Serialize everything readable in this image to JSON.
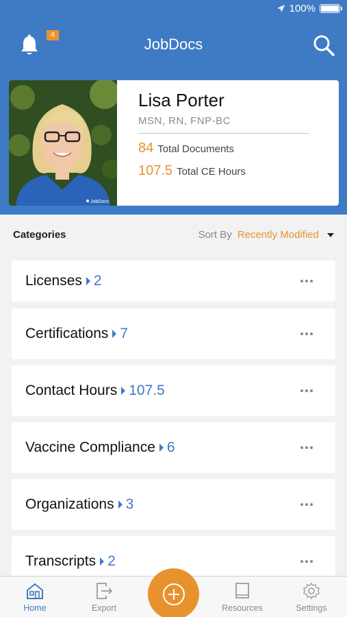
{
  "status_bar": {
    "battery": "100%"
  },
  "header": {
    "app_title": "JobDocs",
    "notification_count": "4",
    "accent_color": "#3f7bc4"
  },
  "profile": {
    "name": "Lisa Porter",
    "credentials": "MSN, RN, FNP-BC",
    "total_documents_value": "84",
    "total_documents_label": "Total Documents",
    "total_ce_value": "107.5",
    "total_ce_label": "Total CE Hours",
    "highlight_color": "#e8922f"
  },
  "categories_header": {
    "title": "Categories",
    "sort_by_label": "Sort By",
    "sort_value": "Recently Modified"
  },
  "categories": [
    {
      "name": "Licenses",
      "count": "2"
    },
    {
      "name": "Certifications",
      "count": "7"
    },
    {
      "name": "Contact Hours",
      "count": "107.5"
    },
    {
      "name": "Vaccine Compliance",
      "count": "6"
    },
    {
      "name": "Organizations",
      "count": "3"
    },
    {
      "name": "Transcripts",
      "count": "2"
    }
  ],
  "tabbar": {
    "home": "Home",
    "export": "Export",
    "resources": "Resources",
    "settings": "Settings"
  },
  "icons": [
    "location-arrow-icon",
    "battery-icon",
    "bell-icon",
    "search-icon",
    "caret-down-icon",
    "chevron-right-icon",
    "more-icon",
    "home-icon",
    "export-icon",
    "add-icon",
    "book-icon",
    "gear-icon"
  ]
}
